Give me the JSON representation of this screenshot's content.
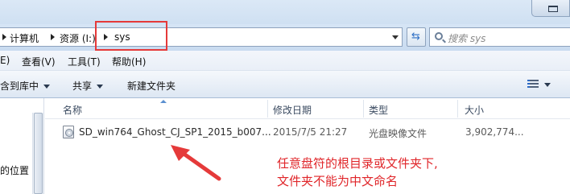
{
  "address": {
    "crumbs": [
      "计算机",
      "资源 (I:)",
      "sys"
    ]
  },
  "search": {
    "placeholder": "搜索 sys"
  },
  "menu": {
    "items": [
      "E)",
      "查看(V)",
      "工具(T)",
      "帮助(H)"
    ]
  },
  "toolbar": {
    "include_label": "含到库中",
    "share_label": "共享",
    "new_folder_label": "新建文件夹"
  },
  "nav": {
    "partial_label": "的位置"
  },
  "columns": {
    "name": "名称",
    "modified": "修改日期",
    "type": "类型",
    "size": "大小"
  },
  "files": [
    {
      "name": "SD_win764_Ghost_CJ_SP1_2015_b007...",
      "modified": "2015/7/5 21:27",
      "type": "光盘映像文件",
      "size": "3,902,774..."
    }
  ],
  "annotation": {
    "line1": "任意盘符的根目录或文件夹下,",
    "line2": "文件夹不能为中文命名",
    "color": "#e0262a"
  },
  "highlight_color": "#e53a3a",
  "icons": {
    "window": "maximize-icon",
    "refresh": "refresh-icon",
    "search": "search-icon",
    "file": "disc-image-file-icon",
    "view": "view-options-icon"
  }
}
